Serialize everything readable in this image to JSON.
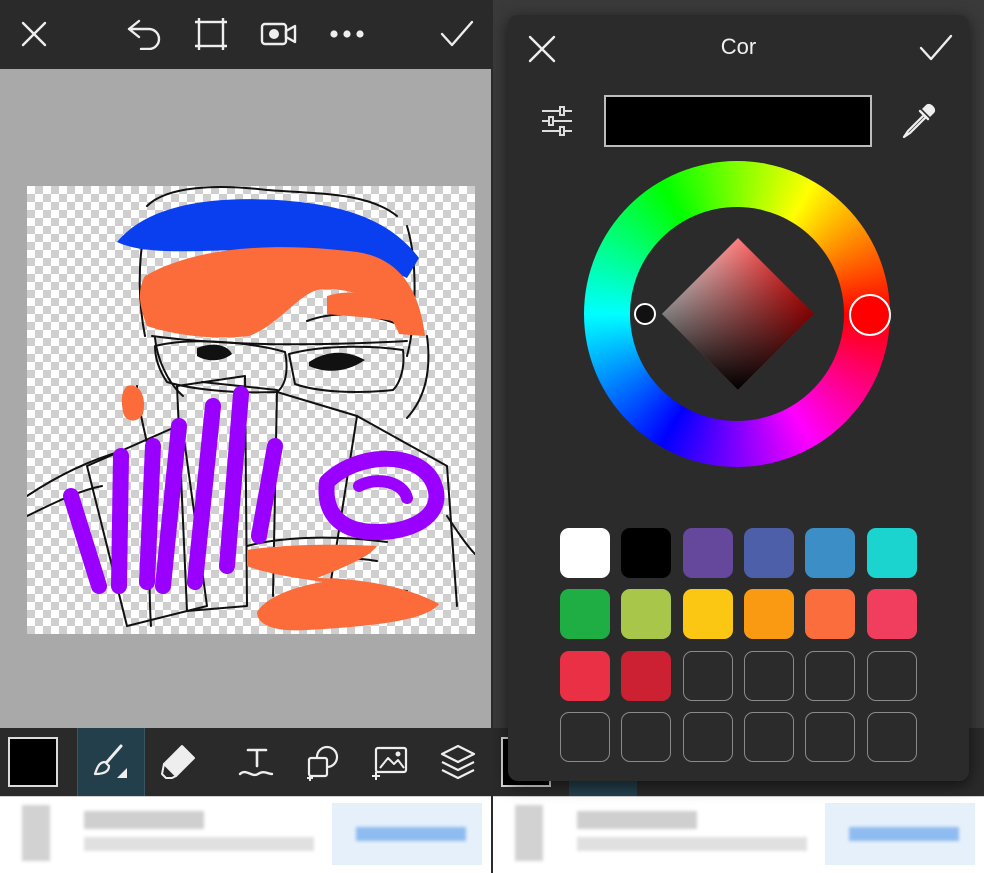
{
  "left": {
    "topbar": {
      "icons": [
        "close-icon",
        "undo-icon",
        "crop-icon",
        "video-record-icon",
        "more-icon",
        "confirm-icon"
      ]
    },
    "toolbar": {
      "current_color": "#000000",
      "tools": [
        "brush-icon",
        "eraser-icon",
        "text-icon",
        "shape-icon",
        "add-image-icon",
        "layers-icon"
      ],
      "active_tool": "brush-icon"
    }
  },
  "color_dialog": {
    "title": "Cor",
    "current_color": "#000000",
    "hue_color": "#ff0000",
    "swatches": [
      "#ffffff",
      "#000000",
      "#65489b",
      "#4d5fa8",
      "#3b8fc6",
      "#1bd3cf",
      "#1fae43",
      "#a8c64a",
      "#fbc712",
      "#fa9a12",
      "#fb6d3c",
      "#f23e5e",
      "#ea3044",
      "#cc2132",
      "",
      "",
      "",
      "",
      "",
      "",
      "",
      "",
      "",
      ""
    ]
  }
}
